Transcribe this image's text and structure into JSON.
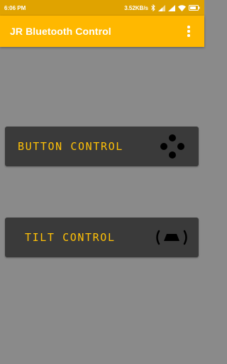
{
  "status_bar": {
    "time": "6:06 PM",
    "network_speed": "3.52KB/s",
    "battery_icon": "battery-icon",
    "wifi_icon": "wifi-icon",
    "signal_icon": "signal-icon",
    "bluetooth_icon": "bluetooth-icon"
  },
  "app_bar": {
    "title": "JR Bluetooth Control",
    "menu_icon": "overflow-menu-icon"
  },
  "controls": {
    "button_control": {
      "label": "BUTTON CONTROL",
      "icon": "gamepad-buttons-icon"
    },
    "tilt_control": {
      "label": "TILT CONTROL",
      "icon": "tilt-car-icon"
    }
  },
  "colors": {
    "status_bar": "#e0a300",
    "app_bar": "#ffb800",
    "background": "#8a8a8a",
    "button_bg": "#3a3a3a",
    "label": "#ffc107"
  }
}
